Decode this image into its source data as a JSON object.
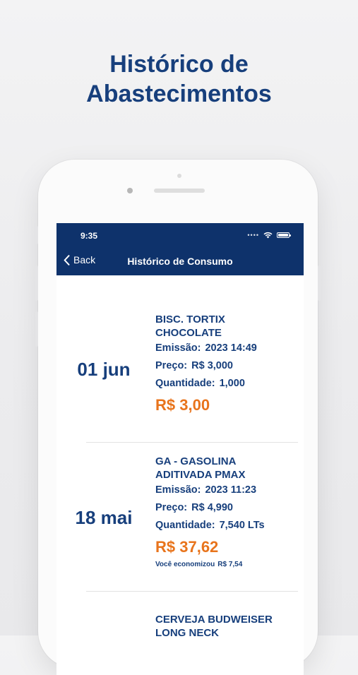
{
  "promo": {
    "title_line1": "Histórico de",
    "title_line2": "Abastecimentos"
  },
  "status_bar": {
    "time": "9:35"
  },
  "header": {
    "back_label": "Back",
    "title": "Histórico de Consumo",
    "bg_color": "#0e326b"
  },
  "labels": {
    "emission": "Emissão:",
    "price": "Preço:",
    "quantity": "Quantidade:",
    "savings": "Você economizou"
  },
  "records": [
    {
      "date": "01 jun",
      "product_line1": "BISC. TORTIX",
      "product_line2": "CHOCOLATE",
      "emission": "2023 14:49",
      "price": "R$ 3,000",
      "quantity": "1,000",
      "total": "R$ 3,00"
    },
    {
      "date": "18 mai",
      "product_line1": "GA - GASOLINA",
      "product_line2": "ADITIVADA PMAX",
      "emission": "2023 11:23",
      "price": "R$ 4,990",
      "quantity": "7,540 LTs",
      "total": "R$ 37,62",
      "savings": "R$ 7,54"
    },
    {
      "product_line1": "CERVEJA BUDWEISER",
      "product_line2": "LONG NECK"
    }
  ],
  "colors": {
    "accent_blue": "#173f7c",
    "total_orange": "#e8741c"
  }
}
